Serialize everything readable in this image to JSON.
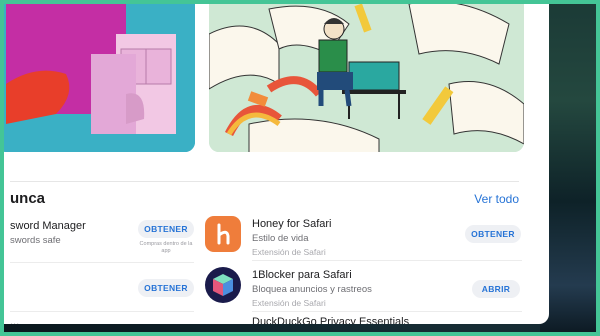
{
  "section": {
    "title": "unca",
    "see_all": "Ver todo"
  },
  "left_apps": [
    {
      "name": "sword Manager",
      "subtitle": "swords safe",
      "button": "OBTENER",
      "note": "Compras dentro de la app"
    },
    {
      "name": "",
      "subtitle": "",
      "button": "OBTENER"
    },
    {
      "name": "...",
      "subtitle": ""
    }
  ],
  "right_apps": [
    {
      "name": "Honey for Safari",
      "subtitle": "Estilo de vida",
      "category": "Extensión de Safari",
      "button": "OBTENER",
      "icon": "honey-h-icon",
      "icon_color": "#ef7d3b"
    },
    {
      "name": "1Blocker para Safari",
      "subtitle": "Bloquea anuncios y rastreos",
      "category": "Extensión de Safari",
      "button": "ABRIR",
      "icon": "1blocker-cube-icon",
      "icon_color": "#1a1b4b"
    },
    {
      "name": "DuckDuckGo Privacy Essentials"
    }
  ],
  "colors": {
    "accent": "#2673d6",
    "frame": "#44c596"
  }
}
